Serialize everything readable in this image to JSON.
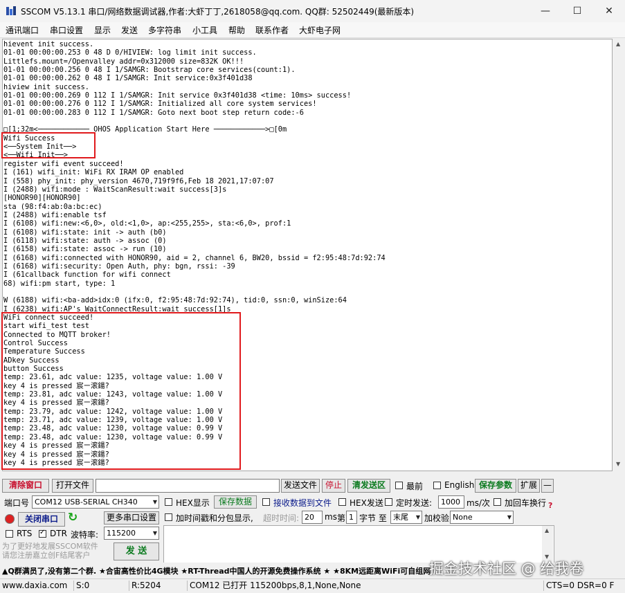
{
  "window": {
    "title": "SSCOM V5.13.1 串口/网络数据调试器,作者:大虾丁丁,2618058@qq.com. QQ群: 52502449(最新版本)",
    "minimize": "—",
    "maximize": "☐",
    "close": "✕"
  },
  "menu": [
    "通讯端口",
    "串口设置",
    "显示",
    "发送",
    "多字符串",
    "小工具",
    "帮助",
    "联系作者",
    "大虾电子网"
  ],
  "terminal": {
    "lines": [
      "hievent init success.",
      "01-01 00:00:00.253 0 48 D 0/HIVIEW: log limit init success.",
      "Littlefs.mount=/Openvalley addr=0x312000 size=832K OK!!!",
      "01-01 00:00:00.256 0 48 I 1/SAMGR: Bootstrap core services(count:1).",
      "01-01 00:00:00.262 0 48 I 1/SAMGR: Init service:0x3f401d38",
      "hiview init success.",
      "01-01 00:00:00.269 0 112 I 1/SAMGR: Init service 0x3f401d38 <time: 10ms> success!",
      "01-01 00:00:00.276 0 112 I 1/SAMGR: Initialized all core system services!",
      "01-01 00:00:00.283 0 112 I 1/SAMGR: Goto next boot step return code:-6",
      "",
      "□[1;32m<──────────── OHOS Application Start Here ────────────>□[0m",
      "Wifi Success",
      "<──System Init──>",
      "<──Wifi Init──>",
      "register wifi event succeed!",
      "I (161) wifi_init: WiFi RX IRAM OP enabled",
      "I (558) phy_init: phy_version 4670,719f9f6,Feb 18 2021,17:07:07",
      "I (2488) wifi:mode : WaitScanResult:wait success[3]s",
      "[HONOR90][HONOR90]",
      "sta (98:f4:ab:0a:bc:ec)",
      "I (2488) wifi:enable tsf",
      "I (6108) wifi:new:<6,0>, old:<1,0>, ap:<255,255>, sta:<6,0>, prof:1",
      "I (6108) wifi:state: init -> auth (b0)",
      "I (6118) wifi:state: auth -> assoc (0)",
      "I (6158) wifi:state: assoc -> run (10)",
      "I (6168) wifi:connected with HONOR90, aid = 2, channel 6, BW20, bssid = f2:95:48:7d:92:74",
      "I (6168) wifi:security: Open Auth, phy: bgn, rssi: -39",
      "I (61callback function for wifi connect",
      "68) wifi:pm start, type: 1",
      "",
      "W (6188) wifi:<ba-add>idx:0 (ifx:0, f2:95:48:7d:92:74), tid:0, ssn:0, winSize:64",
      "I (6238) wifi:AP's WaitConnectResult:wait success[1]s",
      "WiFi connect succeed!",
      "start wifi_test test",
      "Connected to MQTT broker!",
      "Control Success",
      "Temperature Success",
      "ADkey Success",
      "button Success",
      "temp: 23.61, adc value: 1235, voltage value: 1.00 V",
      "key 4 is pressed 宸ー滚鍚?",
      "temp: 23.81, adc value: 1243, voltage value: 1.00 V",
      "key 4 is pressed 宸ー滚鍚?",
      "temp: 23.79, adc value: 1242, voltage value: 1.00 V",
      "temp: 23.71, adc value: 1239, voltage value: 1.00 V",
      "temp: 23.48, adc value: 1230, voltage value: 0.99 V",
      "temp: 23.48, adc value: 1230, voltage value: 0.99 V",
      "key 4 is pressed 宸ー滚鍚?",
      "key 4 is pressed 宸ー滚鍚?",
      "key 4 is pressed 宸ー滚鍚?"
    ]
  },
  "toolbar1": {
    "clear_window": "清除窗口",
    "open_file": "打开文件",
    "file_path": "",
    "send_file": "发送文件",
    "stop": "停止",
    "clear_send": "清发送区",
    "topmost": "最前",
    "english": "English",
    "save_params": "保存参数",
    "expand": "扩展",
    "collapse": "—"
  },
  "row2": {
    "port_label": "端口号",
    "port_value": "COM12 USB-SERIAL CH340",
    "hex_display": "HEX显示",
    "save_data": "保存数据",
    "recv_to_file": "接收数据到文件",
    "hex_send": "HEX发送",
    "timed_send": "定时发送:",
    "interval_value": "1000",
    "interval_unit": "ms/次",
    "add_crlf": "加回车换行",
    "help": "?"
  },
  "row3": {
    "close_port": "关闭串口",
    "refresh_icon": "↻",
    "more_settings": "更多串口设置",
    "timestamp_label": "加时间戳和分包显示,",
    "timeout_label": "超时时间:",
    "timeout_value": "20",
    "timeout_unit": "ms",
    "nth_label": "第",
    "nth_value": "1",
    "byte_label": "字节 至",
    "end_value": "末尾",
    "checksum_label": "加校验",
    "checksum_value": "None"
  },
  "row4": {
    "rts": "RTS",
    "dtr": "DTR",
    "baud_label": "波特率:",
    "baud_value": "115200"
  },
  "send_panel": {
    "notice": "为了更好地发展SSCOM软件\n请您注册嘉立创F结尾客户",
    "send_button": "发 送"
  },
  "promo": "▲Q群满员了,没有第二个群. ★合宙高性价比4G模块 ★RT-Thread中国人的开源免费操作系统 ★ ★8KM远距离WiFi可自组网",
  "watermark": "掘金技术社区 @ 给我卷",
  "status": {
    "website": "www.daxia.com",
    "sent": "S:0",
    "received": "R:5204",
    "port_status": "COM12 已打开  115200bps,8,1,None,None",
    "signals": "CTS=0 DSR=0 F"
  },
  "colors": {
    "highlight": "#e0191c",
    "red_button": "#c8102e",
    "green_button": "#0a7a1e"
  }
}
